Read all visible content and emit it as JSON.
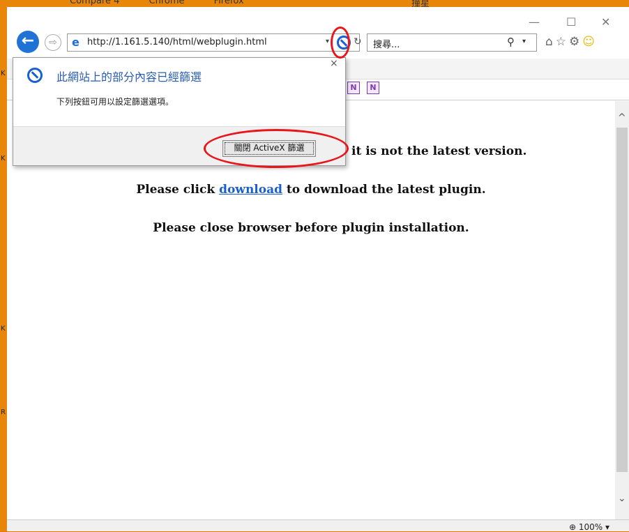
{
  "background_tabs": [
    "Compare 4",
    "Chrome",
    "Firefox"
  ],
  "background_right": "撞星",
  "left_strip_letters": [
    "K",
    "K",
    "K",
    "R"
  ],
  "window_controls": {
    "minimize": "—",
    "maximize": "☐",
    "close": "✕"
  },
  "address_bar": {
    "url": "http://1.161.5.140/html/webplugin.html"
  },
  "search": {
    "placeholder": "搜尋..."
  },
  "toolbar_icons": [
    "home-icon",
    "favorites-star-icon",
    "settings-gear-icon",
    "feedback-smiley-icon"
  ],
  "popup": {
    "title": "此網站上的部分內容已經篩選",
    "description": "下列按鈕可用以設定篩選選項。",
    "button_label": "關閉 ActiveX 篩選",
    "close_label": "×"
  },
  "content": {
    "line1_tail": "it is not the latest version.",
    "line2_prefix": "Please click ",
    "line2_link": "download",
    "line2_suffix": " to download the latest plugin.",
    "line3": "Please close browser before plugin installation."
  },
  "status_bar": {
    "zoom": "100%"
  },
  "colors": {
    "accent_blue": "#1f73d6",
    "annotation_red": "#e8161a",
    "frame_orange": "#e8860a"
  }
}
